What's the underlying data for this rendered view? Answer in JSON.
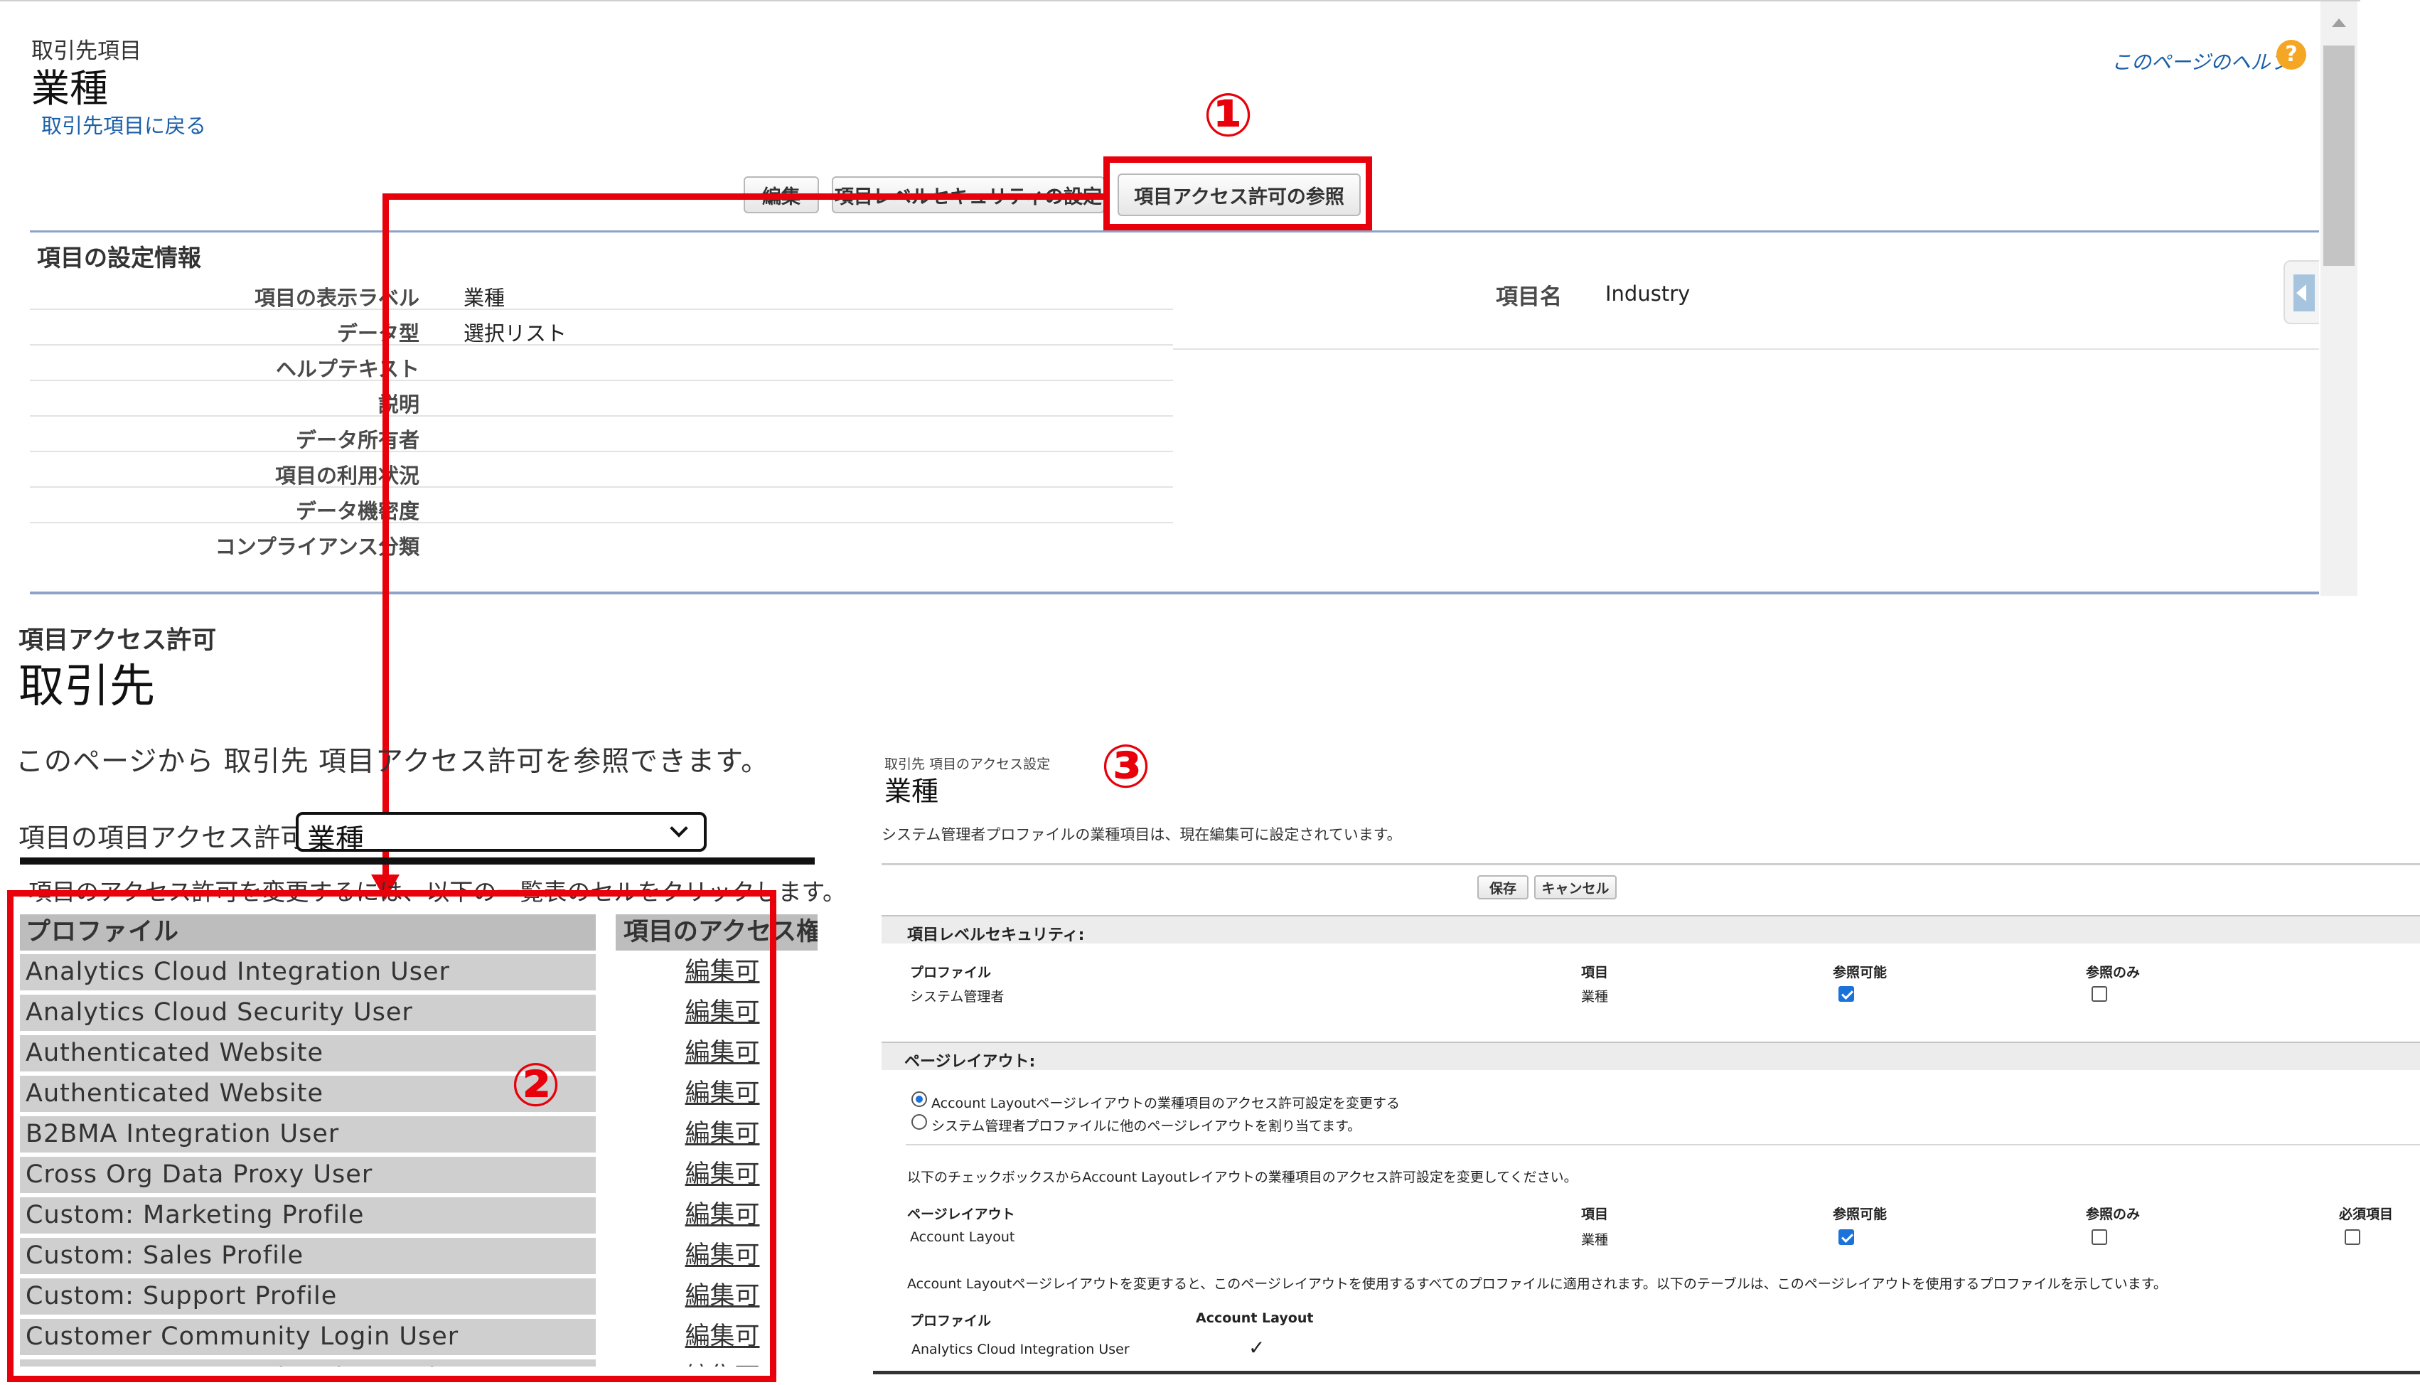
{
  "top": {
    "object_label": "取引先項目",
    "field_title": "業種",
    "back_link": "取引先項目に戻る",
    "help_link": "このページのヘルプ",
    "buttons": [
      "編集",
      "項目レベルセキュリティの設定",
      "項目アクセス許可の参照"
    ],
    "section_title": "項目の設定情報",
    "details": [
      {
        "label": "項目の表示ラベル",
        "value": "業種"
      },
      {
        "label": "データ型",
        "value": "選択リスト"
      },
      {
        "label": "ヘルプテキスト",
        "value": ""
      },
      {
        "label": "説明",
        "value": ""
      },
      {
        "label": "データ所有者",
        "value": ""
      },
      {
        "label": "項目の利用状況",
        "value": ""
      },
      {
        "label": "データ機密度",
        "value": ""
      },
      {
        "label": "コンプライアンス分類",
        "value": ""
      }
    ],
    "field_name_label": "項目名",
    "field_name_value": "Industry"
  },
  "markers": {
    "one": "①",
    "two": "②",
    "three": "③"
  },
  "access": {
    "label": "項目アクセス許可",
    "object": "取引先",
    "description": "このページから 取引先 項目アクセス許可を参照できます。",
    "select_label": "項目の項目アクセス許可:",
    "select_value": "業種",
    "instruction": "項目のアクセス許可を変更するには、以下の一覧表のセルをクリックします。",
    "col_profile": "プロファイル",
    "col_access": "項目のアクセス権",
    "rows": [
      {
        "profile": "Analytics Cloud Integration User",
        "access": "編集可"
      },
      {
        "profile": "Analytics Cloud Security User",
        "access": "編集可"
      },
      {
        "profile": "Authenticated Website",
        "access": "編集可"
      },
      {
        "profile": "Authenticated Website",
        "access": "編集可"
      },
      {
        "profile": "B2BMA Integration User",
        "access": "編集可"
      },
      {
        "profile": "Cross Org Data Proxy User",
        "access": "編集可"
      },
      {
        "profile": "Custom: Marketing Profile",
        "access": "編集可"
      },
      {
        "profile": "Custom: Sales Profile",
        "access": "編集可"
      },
      {
        "profile": "Custom: Support Profile",
        "access": "編集可"
      },
      {
        "profile": "Customer Community Login User",
        "access": "編集可"
      },
      {
        "profile": "Customer Community Plus Login User",
        "access": "編集可"
      }
    ]
  },
  "settings": {
    "breadcrumb": "取引先 項目のアクセス設定",
    "title": "業種",
    "note": "システム管理者プロファイルの業種項目は、現在編集可に設定されています。",
    "save": "保存",
    "cancel": "キャンセル",
    "fls_title": "項目レベルセキュリティ:",
    "fls_headers": [
      "プロファイル",
      "項目",
      "参照可能",
      "参照のみ"
    ],
    "fls_row": {
      "profile": "システム管理者",
      "field": "業種",
      "visible": true,
      "readonly": false
    },
    "layout_title": "ページレイアウト:",
    "radio1": "Account Layoutページレイアウトの業種項目のアクセス許可設定を変更する",
    "radio2": "システム管理者プロファイルに他のページレイアウトを割り当てます。",
    "layout_instruction": "以下のチェックボックスからAccount Layoutレイアウトの業種項目のアクセス許可設定を変更してください。",
    "layout_headers": [
      "ページレイアウト",
      "項目",
      "参照可能",
      "参照のみ",
      "必須項目"
    ],
    "layout_row": {
      "layout": "Account Layout",
      "field": "業種",
      "visible": true,
      "readonly": false,
      "required": false
    },
    "layout_note": "Account Layoutページレイアウトを変更すると、このページレイアウトを使用するすべてのプロファイルに適用されます。以下のテーブルは、このページレイアウトを使用するプロファイルを示しています。",
    "profile_headers": [
      "プロファイル",
      "Account Layout"
    ],
    "profile_row": {
      "profile": "Analytics Cloud Integration User",
      "mark": "✓"
    }
  },
  "colors": {
    "accent": "#e8000b",
    "link": "#1a5fa8",
    "checkbox": "#1b72d8"
  }
}
